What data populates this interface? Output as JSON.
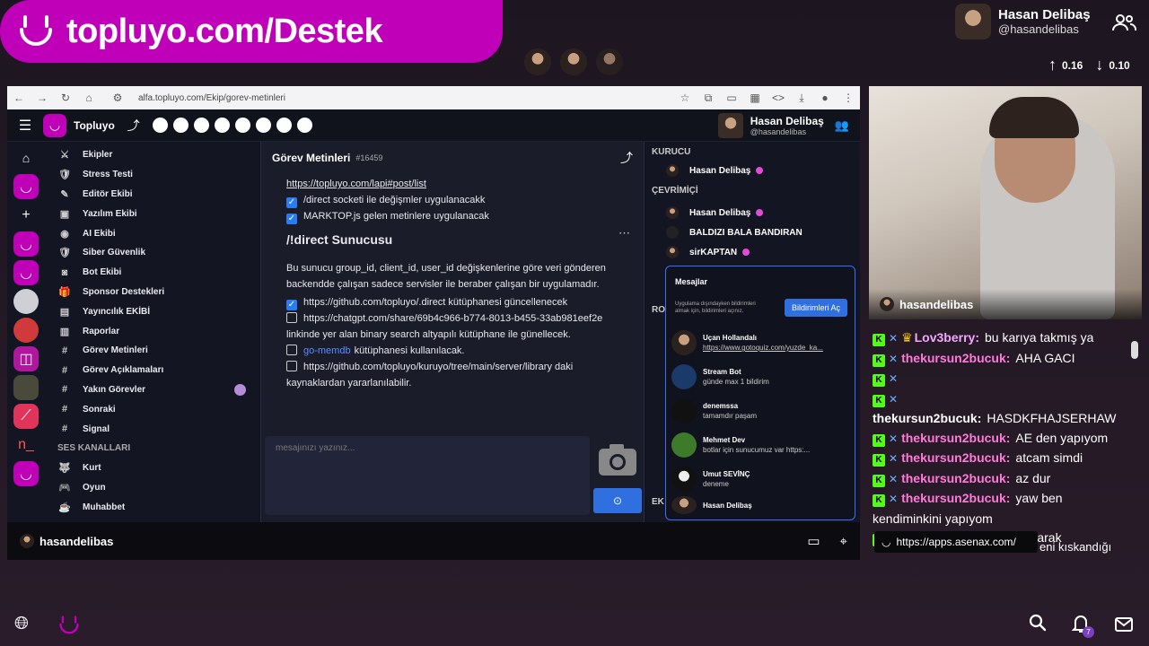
{
  "banner": {
    "text": "topluyo.com/Destek"
  },
  "streamer": {
    "name": "Hasan Delibaş",
    "handle": "@hasandelibas",
    "up": "0.16",
    "down": "0.10"
  },
  "browser": {
    "url": "alfa.topluyo.com/Ekip/gorev-metinleri"
  },
  "app": {
    "brand": "Topluyo",
    "user_name": "Hasan Delibaş",
    "user_handle": "@hasandelibas"
  },
  "nav": {
    "items": [
      "Ekipler",
      "Stress Testi",
      "Editör Ekibi",
      "Yazılım Ekibi",
      "AI Ekibi",
      "Siber Güvenlik",
      "Bot Ekibi",
      "Sponsor Destekleri",
      "Yayıncılık EKİBİ",
      "Raporlar",
      "Görev Metinleri",
      "Görev Açıklamaları",
      "Yakın Görevler",
      "Sonraki",
      "Signal"
    ],
    "voice_header": "SES KANALLARI",
    "voice_items": [
      "Kurt",
      "Oyun",
      "Muhabbet"
    ]
  },
  "channel": {
    "title": "Görev Metinleri",
    "id": "#16459"
  },
  "content": {
    "link1": "https://topluyo.com/lapi#post/list",
    "check1": "/direct socketi ile değişmler uygulanacakk",
    "check2": "MARKTOP.js gelen metinlere uygulanacak",
    "heading": "/!direct Sunucusu",
    "para": "Bu sunucu group_id, client_id, user_id değişkenlerine göre veri gönderen backendde çalışan sadece servisler ile beraber çalışan bir uygulamadır.",
    "check3": "https://github.com/topluyo/.direct kütüphanesi güncellenecek",
    "check4": "https://chatgpt.com/share/69b4c966-b774-8013-b455-33ab981eef2e linkinde yer alan binary search altyapılı kütüphane ile günellecek.",
    "check5_link": "go-memdb",
    "check5": "kütüphanesi kullanılacak.",
    "check6": "https://github.com/topluyo/kuruyo/tree/main/server/library daki kaynaklardan yararlanılabilir.",
    "input_placeholder": "mesajınızı yazınız..."
  },
  "members": {
    "founder_header": "KURUCU",
    "founder": "Hasan Delibaş",
    "online_header": "ÇEVRİMİÇİ",
    "online": [
      "Hasan Delibaş",
      "BALDIZI BALA BANDIRAN",
      "sirKAPTAN"
    ],
    "ro": "RO",
    "ek": "EK"
  },
  "messages": {
    "title": "Mesajlar",
    "notice": "Uygulama dışındayken bildirimleri almak için, bildirimleri açınız.",
    "enable_btn": "Bildirimleri Aç",
    "items": [
      {
        "name": "Uçan Hollandalı",
        "text": "https://www.gotoquiz.com/yuzde_ka..."
      },
      {
        "name": "Stream Bot",
        "text": "günde max 1 bildirim"
      },
      {
        "name": "denemssa",
        "text": "tamamdır paşam"
      },
      {
        "name": "Mehmet Dev",
        "text": "botlar için sunucumuz var https:..."
      },
      {
        "name": "Umut SEVİNÇ",
        "text": "deneme"
      },
      {
        "name": "Hasan Delibaş",
        "text": ""
      }
    ]
  },
  "bottom": {
    "user": "hasandelibas"
  },
  "cam": {
    "label": "hasandelibas"
  },
  "chat": {
    "lines": [
      {
        "user": "Lov3berry:",
        "msg": "bu karıya takmış ya",
        "color": "#f6a6ff"
      },
      {
        "user": "thekursun2bucuk:",
        "msg": "AHA GACI",
        "color": "#ff7ad9"
      },
      {
        "user": "",
        "msg": "",
        "color": "#ff7ad9"
      },
      {
        "user": "thekursun2bucuk:",
        "msg": "HASDKFHAJSERHAW",
        "color": "#ffffff"
      },
      {
        "user": "thekursun2bucuk:",
        "msg": "AE den yapıyom",
        "color": "#ff7ad9"
      },
      {
        "user": "thekursun2bucuk:",
        "msg": "atcam simdi",
        "color": "#ff7ad9"
      },
      {
        "user": "thekursun2bucuk:",
        "msg": "az dur",
        "color": "#ff7ad9"
      },
      {
        "user": "thekursun2bucuk:",
        "msg": "yaw ben kendiminkini yapıyom",
        "color": "#ff7ad9"
      },
      {
        "user": "Lov3berry:",
        "msg": "banner olarak",
        "color": "#f6a6ff"
      }
    ],
    "popup_url": "https://apps.asenax.com/",
    "tail": "eni kıskandığı"
  },
  "footer": {
    "notif_count": "7"
  }
}
